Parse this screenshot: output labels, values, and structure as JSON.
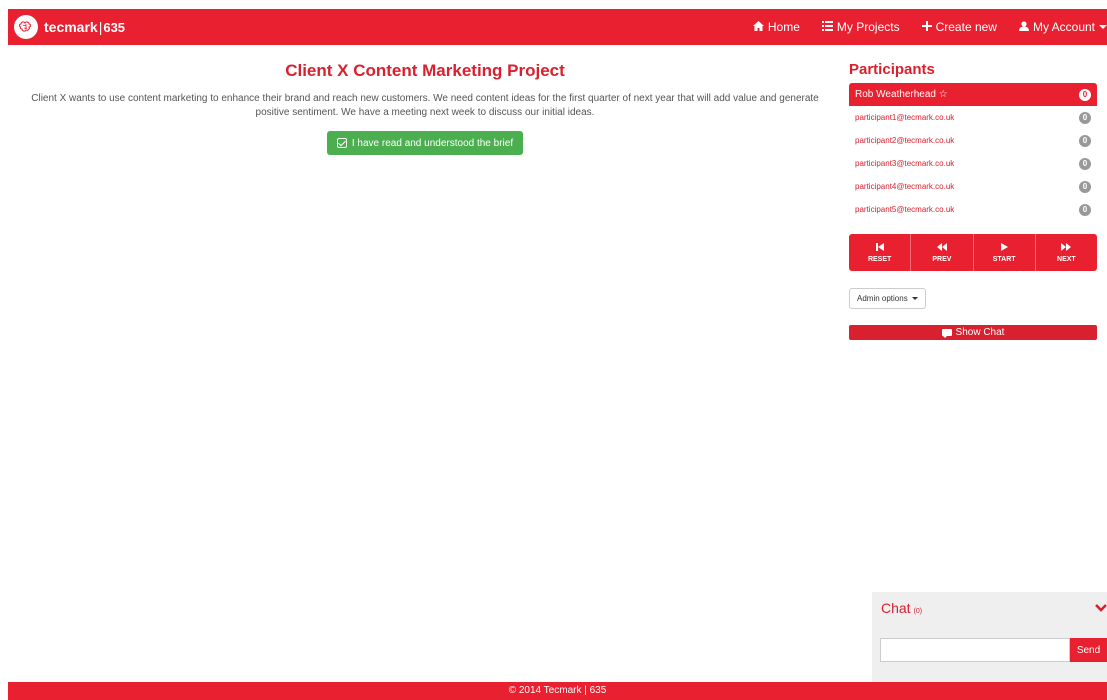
{
  "navbar": {
    "brand_name": "tecmark",
    "brand_separator": "|",
    "brand_number": "635",
    "items": [
      {
        "label": "Home",
        "icon": "home-icon"
      },
      {
        "label": "My Projects",
        "icon": "list-icon"
      },
      {
        "label": "Create new",
        "icon": "plus-icon"
      },
      {
        "label": "My Account",
        "icon": "user-icon"
      }
    ]
  },
  "main": {
    "title": "Client X Content Marketing Project",
    "brief": "Client X wants to use content marketing to enhance their brand and reach new customers. We need content ideas for the first quarter of next year that will add value and generate positive sentiment. We have a meeting next week to discuss our initial ideas.",
    "read_button_label": "I have read and understood the brief"
  },
  "sidebar": {
    "participants_title": "Participants",
    "participants": [
      {
        "name": "Rob Weatherhead ☆",
        "count": "0",
        "active": true
      },
      {
        "name": "participant1@tecmark.co.uk",
        "count": "0",
        "active": false
      },
      {
        "name": "participant2@tecmark.co.uk",
        "count": "0",
        "active": false
      },
      {
        "name": "participant3@tecmark.co.uk",
        "count": "0",
        "active": false
      },
      {
        "name": "participant4@tecmark.co.uk",
        "count": "0",
        "active": false
      },
      {
        "name": "participant5@tecmark.co.uk",
        "count": "0",
        "active": false
      }
    ],
    "controls": [
      {
        "label": "RESET",
        "icon": "reset-icon"
      },
      {
        "label": "PREV",
        "icon": "rewind-icon"
      },
      {
        "label": "START",
        "icon": "play-icon"
      },
      {
        "label": "NEXT",
        "icon": "fast-forward-icon"
      }
    ],
    "admin_options_label": "Admin options",
    "show_chat_label": "Show Chat"
  },
  "chat": {
    "title": "Chat",
    "count": "(0)",
    "input_value": "",
    "input_placeholder": "",
    "send_label": "Send"
  },
  "footer": {
    "text": "© 2014 Tecmark | 635"
  },
  "colors": {
    "brand_red": "#e8202f",
    "title_red": "#d9202e",
    "success_green": "#4bae4f",
    "badge_grey": "#999999",
    "chat_panel_bg": "#efefef"
  }
}
